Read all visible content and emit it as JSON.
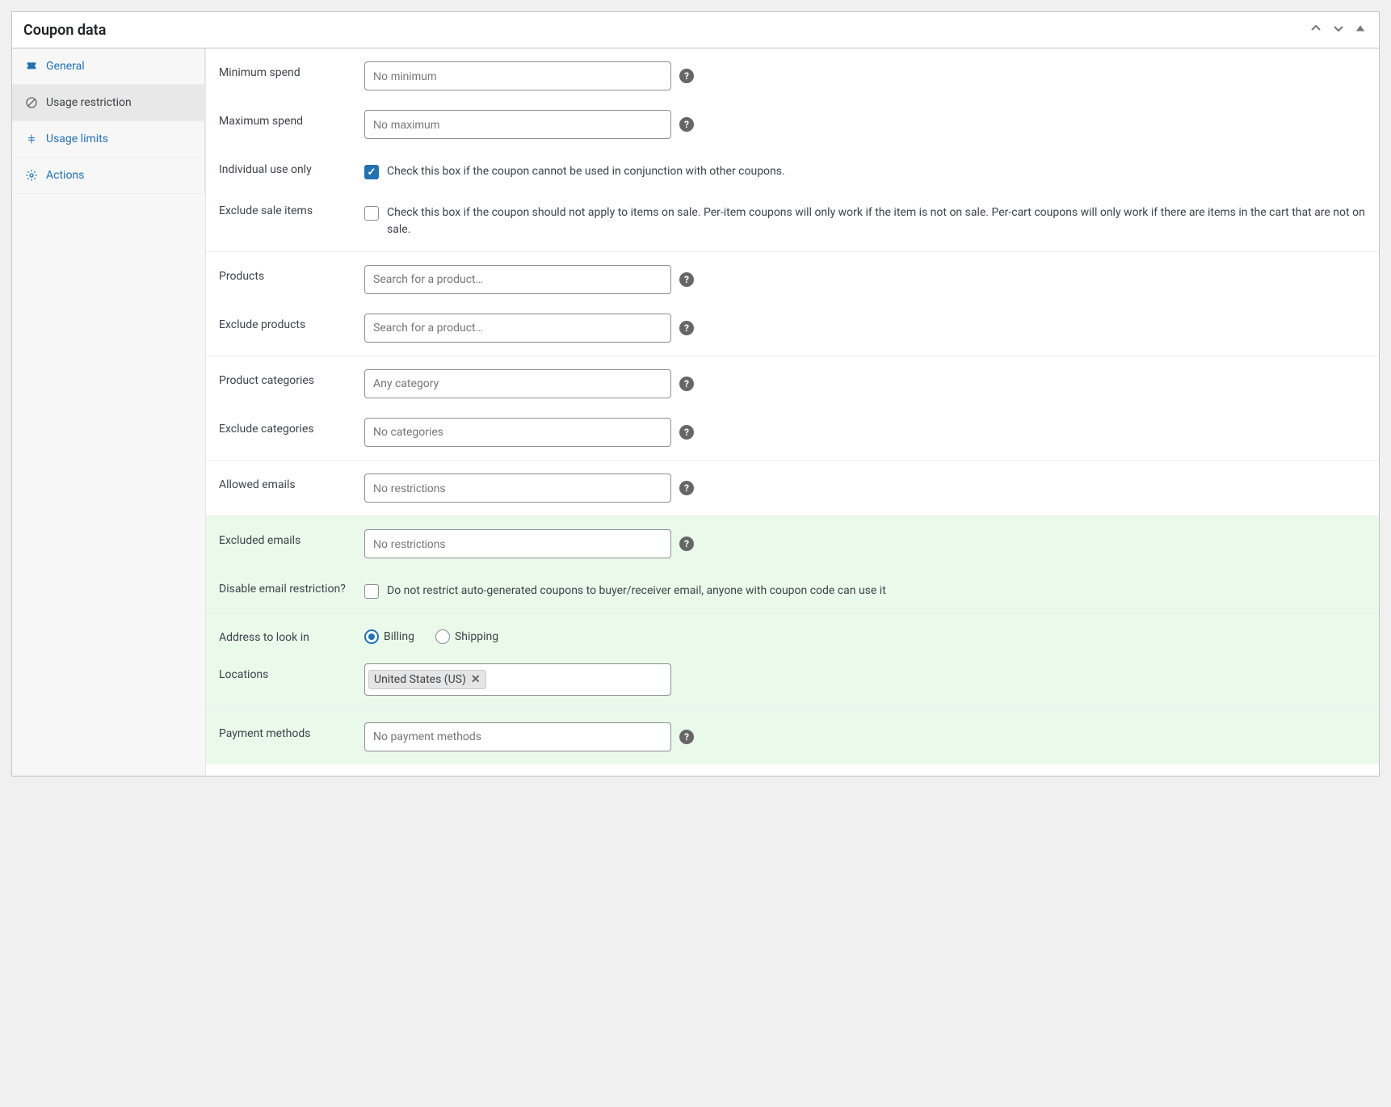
{
  "panel": {
    "title": "Coupon data"
  },
  "tabs": {
    "general": "General",
    "usage_restriction": "Usage restriction",
    "usage_limits": "Usage limits",
    "actions": "Actions"
  },
  "labels": {
    "minimum_spend": "Minimum spend",
    "maximum_spend": "Maximum spend",
    "individual_use": "Individual use only",
    "exclude_sale": "Exclude sale items",
    "products": "Products",
    "exclude_products": "Exclude products",
    "product_categories": "Product categories",
    "exclude_categories": "Exclude categories",
    "allowed_emails": "Allowed emails",
    "excluded_emails": "Excluded emails",
    "disable_email_restriction": "Disable email restriction?",
    "address_look_in": "Address to look in",
    "locations": "Locations",
    "payment_methods": "Payment methods"
  },
  "placeholders": {
    "minimum_spend": "No minimum",
    "maximum_spend": "No maximum",
    "search_product": "Search for a product…",
    "any_category": "Any category",
    "no_categories": "No categories",
    "no_restrictions": "No restrictions",
    "no_payment_methods": "No payment methods"
  },
  "descriptions": {
    "individual_use": "Check this box if the coupon cannot be used in conjunction with other coupons.",
    "exclude_sale": "Check this box if the coupon should not apply to items on sale. Per-item coupons will only work if the item is not on sale. Per-cart coupons will only work if there are items in the cart that are not on sale.",
    "disable_email_restriction": "Do not restrict auto-generated coupons to buyer/receiver email, anyone with coupon code can use it"
  },
  "radios": {
    "billing": "Billing",
    "shipping": "Shipping"
  },
  "values": {
    "individual_use_checked": true,
    "exclude_sale_checked": false,
    "disable_email_checked": false,
    "address_selected": "billing",
    "location_tag": "United States (US)"
  },
  "help_glyph": "?"
}
